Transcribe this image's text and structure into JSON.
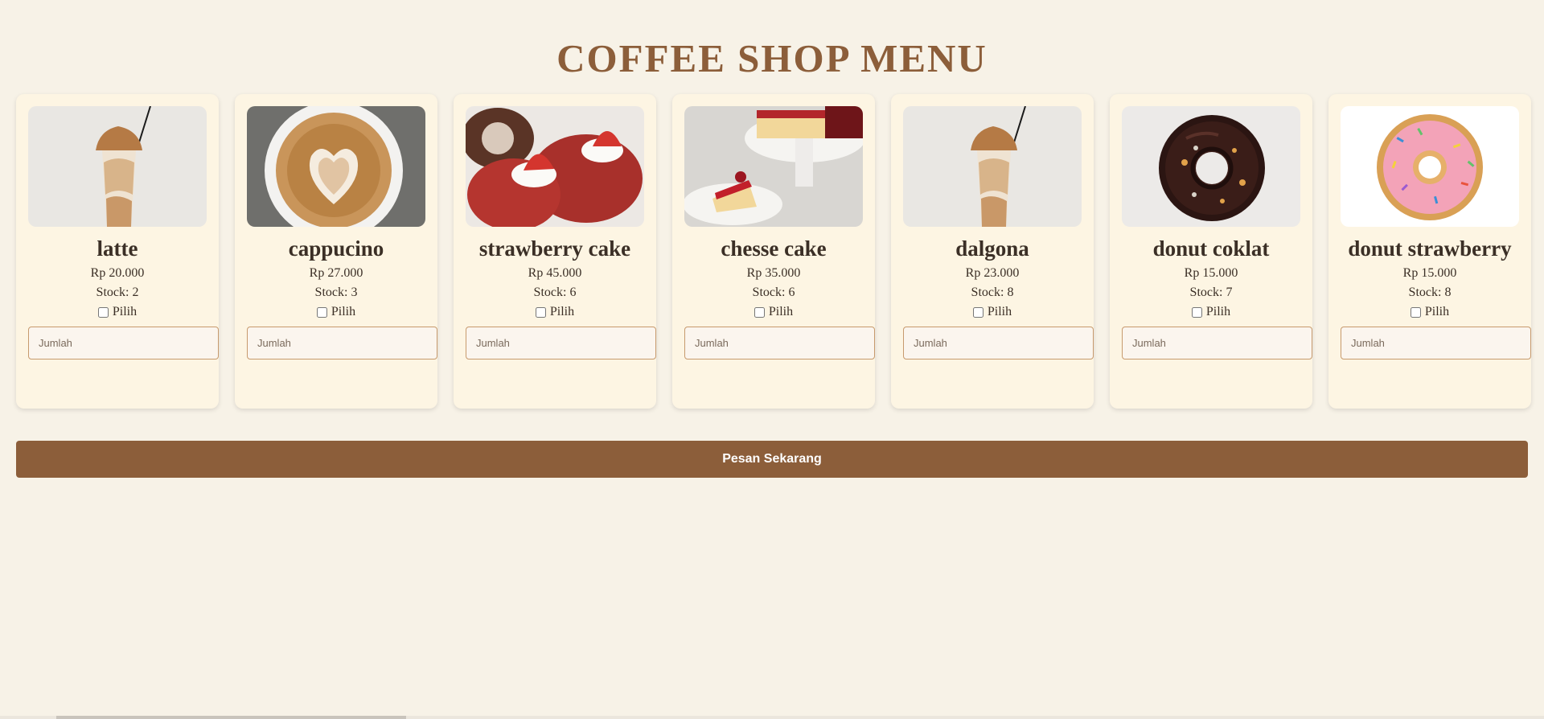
{
  "page": {
    "title": "COFFEE SHOP MENU",
    "order_button": "Pesan Sekarang"
  },
  "colors": {
    "background": "#f7f2e7",
    "card": "#fdf5e3",
    "accent": "#8c5e3a",
    "text": "#3b2f26"
  },
  "menu": [
    {
      "name": "latte",
      "price": "Rp 20.000",
      "stock": "Stock: 2",
      "select_label": "Pilih",
      "qty_placeholder": "Jumlah",
      "image": "iced-coffee-image"
    },
    {
      "name": "cappucino",
      "price": "Rp 27.000",
      "stock": "Stock: 3",
      "select_label": "Pilih",
      "qty_placeholder": "Jumlah",
      "image": "latte-art-image"
    },
    {
      "name": "strawberry cake",
      "price": "Rp 45.000",
      "stock": "Stock: 6",
      "select_label": "Pilih",
      "qty_placeholder": "Jumlah",
      "image": "roll-cake-image"
    },
    {
      "name": "chesse cake",
      "price": "Rp 35.000",
      "stock": "Stock: 6",
      "select_label": "Pilih",
      "qty_placeholder": "Jumlah",
      "image": "cheesecake-image"
    },
    {
      "name": "dalgona",
      "price": "Rp 23.000",
      "stock": "Stock: 8",
      "select_label": "Pilih",
      "qty_placeholder": "Jumlah",
      "image": "iced-coffee-image"
    },
    {
      "name": "donut coklat",
      "price": "Rp 15.000",
      "stock": "Stock: 7",
      "select_label": "Pilih",
      "qty_placeholder": "Jumlah",
      "image": "chocolate-donut-image"
    },
    {
      "name": "donut strawberry",
      "price": "Rp 15.000",
      "stock": "Stock: 8",
      "select_label": "Pilih",
      "qty_placeholder": "Jumlah",
      "image": "pink-donut-image"
    }
  ]
}
